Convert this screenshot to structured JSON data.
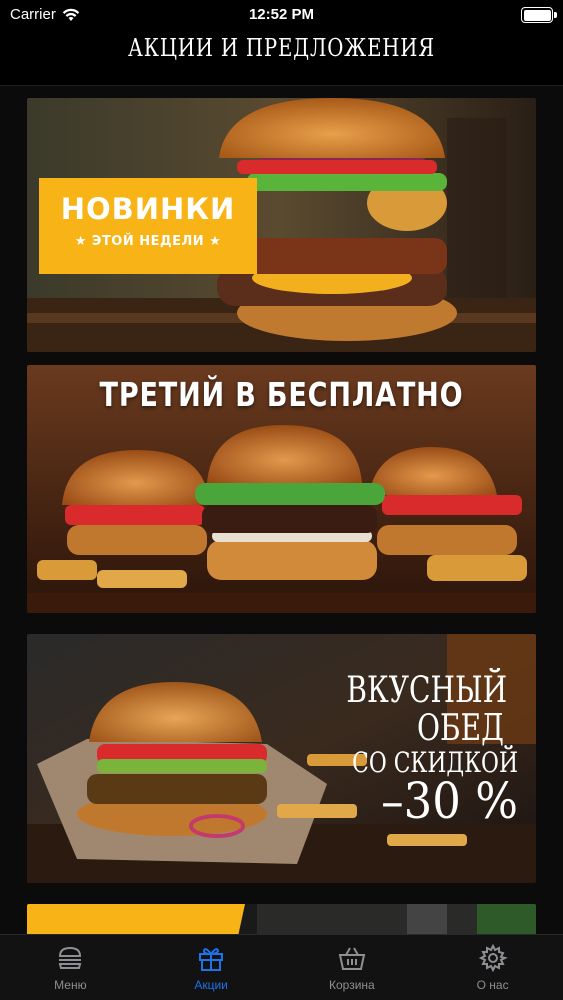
{
  "status_bar": {
    "carrier": "Carrier",
    "time": "12:52 PM"
  },
  "nav": {
    "title": "АКЦИИ И ПРЕДЛОЖЕНИЯ"
  },
  "banners": [
    {
      "badge_title": "НОВИНКИ",
      "badge_subtitle": "★ ЭТОЙ НЕДЕЛИ ★"
    },
    {
      "title": "ТРЕТИЙ В БЕСПЛАТНО"
    },
    {
      "line1": "ВКУСНЫЙ",
      "line2": "ОБЕД",
      "line3": "СО СКИДКОЙ",
      "line4": "–30 %"
    }
  ],
  "tabs": [
    {
      "label": "Меню",
      "icon": "burger-icon"
    },
    {
      "label": "Акции",
      "icon": "gift-icon",
      "active": true
    },
    {
      "label": "Корзина",
      "icon": "basket-icon"
    },
    {
      "label": "О нас",
      "icon": "gear-icon"
    }
  ],
  "colors": {
    "accent": "#1e73e8",
    "badge": "#f8b417",
    "inactive": "#8e8e93"
  }
}
